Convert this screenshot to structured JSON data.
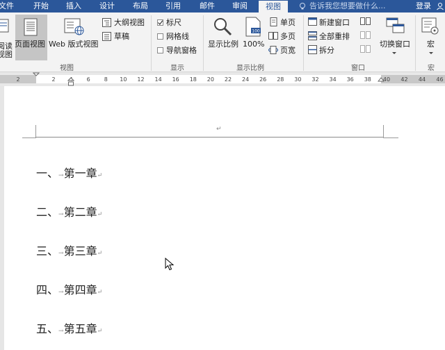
{
  "tabs": [
    {
      "label": "文件",
      "active": false
    },
    {
      "label": "开始",
      "active": false
    },
    {
      "label": "插入",
      "active": false
    },
    {
      "label": "设计",
      "active": false
    },
    {
      "label": "布局",
      "active": false
    },
    {
      "label": "引用",
      "active": false
    },
    {
      "label": "邮件",
      "active": false
    },
    {
      "label": "审阅",
      "active": false
    },
    {
      "label": "视图",
      "active": true
    }
  ],
  "tell_me": "告诉我您想要做什么...",
  "login": "登录",
  "ribbon": {
    "views": {
      "read_mode_line1": "阅读",
      "read_mode_line2": "视图",
      "print_layout": "页面视图",
      "web_layout": "Web 版式视图",
      "outline": "大纲视图",
      "draft": "草稿",
      "group_label": "视图"
    },
    "show": {
      "ruler": "标尺",
      "ruler_checked": true,
      "gridlines": "网格线",
      "gridlines_checked": false,
      "nav_pane": "导航窗格",
      "nav_pane_checked": false,
      "group_label": "显示"
    },
    "zoom": {
      "zoom": "显示比例",
      "hundred": "100%",
      "hundred_badge": "100",
      "one_page": "单页",
      "multi_page": "多页",
      "page_width": "页宽",
      "group_label": "显示比例"
    },
    "window": {
      "new_window": "新建窗口",
      "arrange_all": "全部重排",
      "split": "拆分",
      "switch_windows": "切换窗口",
      "group_label": "窗口"
    },
    "macros": {
      "macros": "宏",
      "group_label": "宏"
    }
  },
  "ruler": {
    "left_ticks": [
      "2"
    ],
    "ticks": [
      "2",
      "4",
      "6",
      "8",
      "10",
      "12",
      "14",
      "16",
      "18",
      "20",
      "22",
      "24",
      "26",
      "28",
      "30",
      "32",
      "34",
      "36",
      "38"
    ],
    "right_ticks": [
      "40",
      "42",
      "44",
      "46"
    ]
  },
  "document": {
    "header_mark": "↵",
    "chapters": [
      {
        "number": "一、",
        "tab": "→",
        "title": "第一章",
        "mark": "↵"
      },
      {
        "number": "二、",
        "tab": "→",
        "title": "第二章",
        "mark": "↵"
      },
      {
        "number": "三、",
        "tab": "→",
        "title": "第三章",
        "mark": "↵"
      },
      {
        "number": "四、",
        "tab": "→",
        "title": "第四章",
        "mark": "↵"
      },
      {
        "number": "五、",
        "tab": "→",
        "title": "第五章",
        "mark": "↵"
      }
    ]
  }
}
